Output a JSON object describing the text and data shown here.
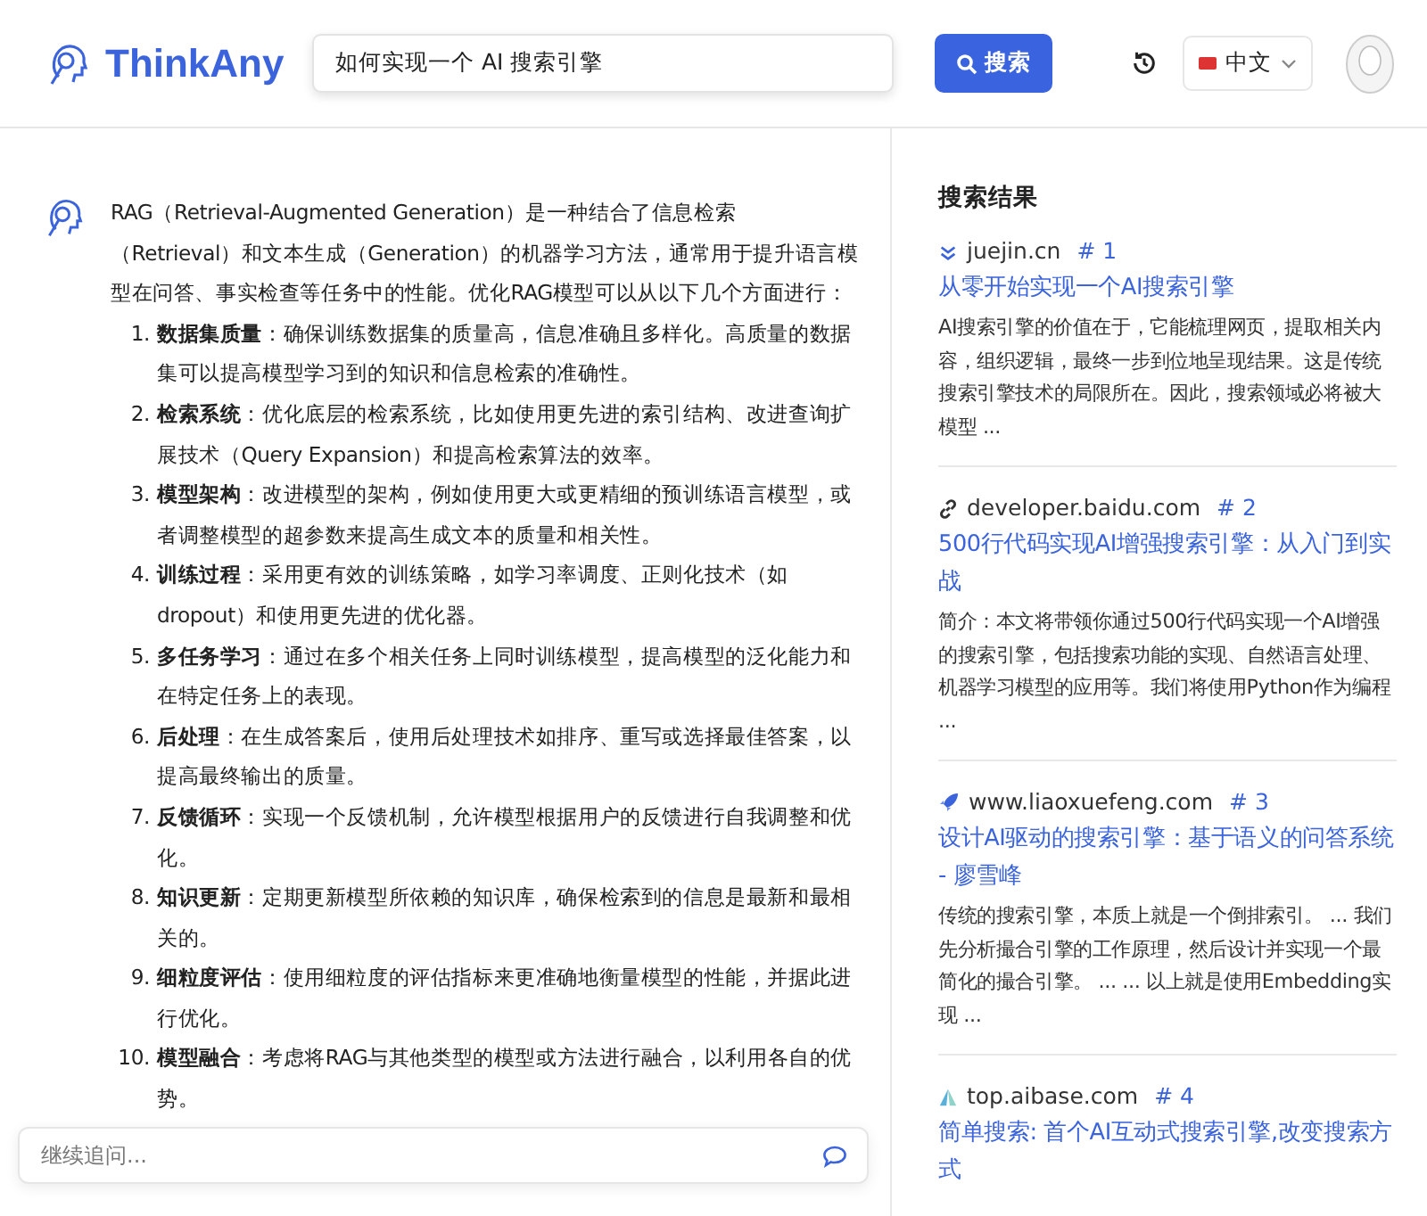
{
  "header": {
    "brand": "ThinkAny",
    "search": {
      "value": "如何实现一个 AI 搜索引擎"
    },
    "search_button": "搜索",
    "language": "中文"
  },
  "answer": {
    "intro": "RAG（Retrieval-Augmented Generation）是一种结合了信息检索（Retrieval）和文本生成（Generation）的机器学习方法，通常用于提升语言模型在问答、事实检查等任务中的性能。优化RAG模型可以从以下几个方面进行：",
    "items": [
      {
        "number": "1.",
        "text": "**数据集质量**：确保训练数据集的质量高，信息准确且多样化。高质量的数据集可以提高模型学习到的知识和信息检索的准确性。"
      },
      {
        "number": "2.",
        "text": "**检索系统**：优化底层的检索系统，比如使用更先进的索引结构、改进查询扩展技术（Query Expansion）和提高检索算法的效率。"
      },
      {
        "number": "3.",
        "text": "**模型架构**：改进模型的架构，例如使用更大或更精细的预训练语言模型，或者调整模型的超参数来提高生成文本的质量和相关性。"
      },
      {
        "number": "4.",
        "text": "**训练过程**：采用更有效的训练策略，如学习率调度、正则化技术（如dropout）和使用更先进的优化器。"
      },
      {
        "number": "5.",
        "text": "**多任务学习**：通过在多个相关任务上同时训练模型，提高模型的泛化能力和在特定任务上的表现。"
      },
      {
        "number": "6.",
        "text": "**后处理**：在生成答案后，使用后处理技术如排序、重写或选择最佳答案，以提高最终输出的质量。"
      },
      {
        "number": "7.",
        "text": "**反馈循环**：实现一个反馈机制，允许模型根据用户的反馈进行自我调整和优化。"
      },
      {
        "number": "8.",
        "text": "**知识更新**：定期更新模型所依赖的知识库，确保检索到的信息是最新和最相关的。"
      },
      {
        "number": "9.",
        "text": "**细粒度评估**：使用细粒度的评估指标来更准确地衡量模型的性能，并据此进行优化。"
      },
      {
        "number": "10.",
        "text": "**模型融合**：考虑将RAG与其他类型的模型或方法进行融合，以利用各自的优势。"
      }
    ]
  },
  "follow_up": {
    "placeholder": "继续追问..."
  },
  "results": {
    "title": "搜索结果",
    "items": [
      {
        "source": "juejin.cn",
        "rank": "# 1",
        "title": "从零开始实现一个AI搜索引擎",
        "snippet": "AI搜索引擎的价值在于，它能梳理网页，提取相关内容，组织逻辑，最终一步到位地呈现结果。这是传统搜索引擎技术的局限所在。因此，搜索领域必将被大模型 ..."
      },
      {
        "source": "developer.baidu.com",
        "rank": "# 2",
        "title": "500行代码实现AI增强搜索引擎：从入门到实战",
        "snippet": "简介：本文将带领你通过500行代码实现一个AI增强的搜索引擎，包括搜索功能的实现、自然语言处理、机器学习模型的应用等。我们将使用Python作为编程 ..."
      },
      {
        "source": "www.liaoxuefeng.com",
        "rank": "# 3",
        "title": "设计AI驱动的搜索引擎：基于语义的问答系统 - 廖雪峰",
        "snippet": "传统的搜索引擎，本质上就是一个倒排索引。 ... 我们先分析撮合引擎的工作原理，然后设计并实现一个最简化的撮合引擎。 ... ... 以上就是使用Embedding实现 ..."
      },
      {
        "source": "top.aibase.com",
        "rank": "# 4",
        "title": "简单搜索: 首个AI互动式搜索引擎,改变搜索方式"
      }
    ]
  }
}
